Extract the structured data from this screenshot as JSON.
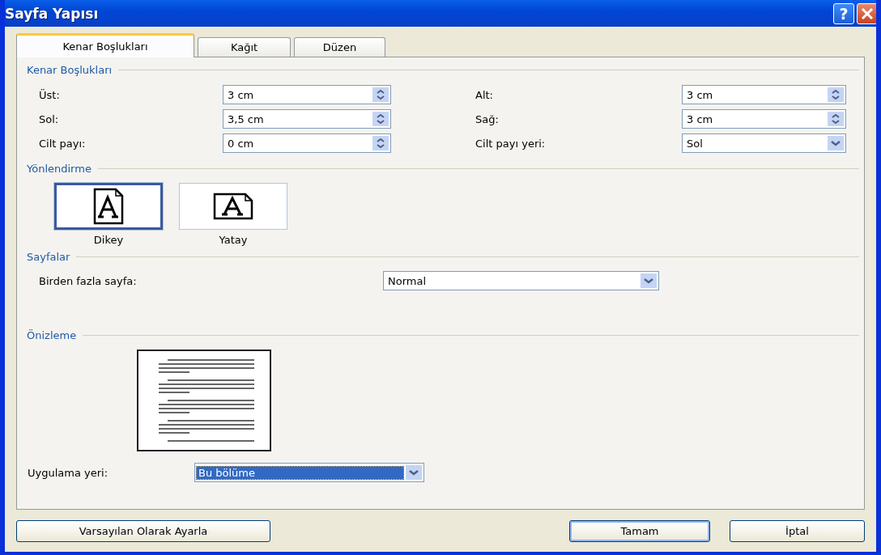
{
  "window": {
    "title": "Sayfa Yapısı",
    "help_button": "?"
  },
  "tabs": [
    {
      "label": "Kenar Boşlukları",
      "selected": true
    },
    {
      "label": "Kağıt",
      "selected": false
    },
    {
      "label": "Düzen",
      "selected": false
    }
  ],
  "margins": {
    "heading": "Kenar Boşlukları",
    "fields": [
      {
        "label": "Üst:",
        "value": "3 cm",
        "kind": "spin"
      },
      {
        "label": "Alt:",
        "value": "3 cm",
        "kind": "spin"
      },
      {
        "label": "Sol:",
        "value": "3,5 cm",
        "kind": "spin"
      },
      {
        "label": "Sağ:",
        "value": "3 cm",
        "kind": "spin"
      },
      {
        "label": "Cilt payı:",
        "value": "0 cm",
        "kind": "spin"
      },
      {
        "label": "Cilt payı yeri:",
        "value": "Sol",
        "kind": "combo"
      }
    ]
  },
  "orientation": {
    "heading": "Yönlendirme",
    "options": [
      {
        "label": "Dikey",
        "kind": "portrait",
        "selected": true
      },
      {
        "label": "Yatay",
        "kind": "landscape",
        "selected": false
      }
    ]
  },
  "pages": {
    "heading": "Sayfalar",
    "label": "Birden fazla sayfa:",
    "value": "Normal"
  },
  "preview": {
    "heading": "Önizleme"
  },
  "apply_to": {
    "label": "Uygulama yeri:",
    "value": "Bu bölüme",
    "selected": true
  },
  "buttons": [
    {
      "label": "Varsayılan Olarak Ayarla",
      "default": false
    },
    {
      "label": "Tamam",
      "default": true
    },
    {
      "label": "İptal",
      "default": false
    }
  ]
}
